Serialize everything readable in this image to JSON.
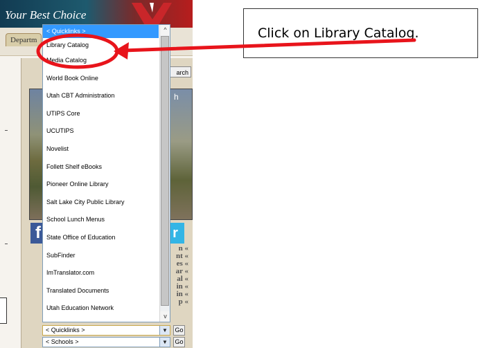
{
  "site": {
    "motto": "Your Best Choice",
    "dept_tab": "Departm",
    "search_fragment": "arch",
    "photo_fragment": "h",
    "facebook_glyph": "f",
    "twitter_glyph": "r",
    "side_link_fragments": [
      "n «",
      "nt «",
      "es «",
      "ar «",
      "al «",
      "in «",
      "in «",
      "p «"
    ]
  },
  "dropdown": {
    "selected": "< Quicklinks >",
    "items": [
      "Library Catalog",
      "Media Catalog",
      "World Book Online",
      "Utah CBT Administration",
      "UTIPS Core",
      "UCUTIPS",
      "Novelist",
      "Follett Shelf eBooks",
      "Pioneer Online Library",
      "Salt Lake City Public Library",
      "School Lunch Menus",
      "State Office of Education",
      "SubFinder",
      "ImTranslator.com",
      "Translated Documents",
      "Utah Education Network"
    ],
    "scroll_up_glyph": "^",
    "scroll_down_glyph": "v"
  },
  "selects": {
    "quicklinks": {
      "value": "< Quicklinks >",
      "go": "Go"
    },
    "schools": {
      "value": "< Schools >",
      "go": "Go"
    }
  },
  "callout": {
    "text": "Click on Library Catalog."
  },
  "colors": {
    "highlight": "#3399ff",
    "annotation_red": "#e8141b"
  }
}
